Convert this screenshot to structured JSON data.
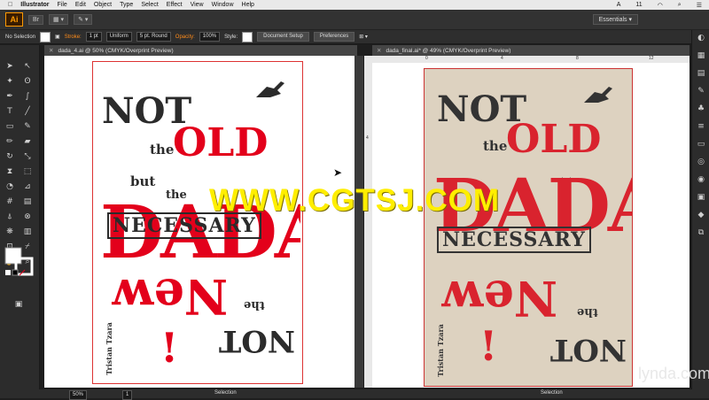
{
  "menubar": {
    "apple": "",
    "app": "Illustrator",
    "items": [
      "File",
      "Edit",
      "Object",
      "Type",
      "Select",
      "Effect",
      "View",
      "Window",
      "Help"
    ],
    "right": [
      "11"
    ]
  },
  "app_bar": {
    "logo": "Ai",
    "bridge": "Br",
    "workspace": "Essentials"
  },
  "control_bar": {
    "selection": "No Selection",
    "stroke_label": "Stroke:",
    "stroke_value": "1 pt",
    "uniform": "Uniform",
    "brush": "5 pt. Round",
    "opacity_label": "Opacity:",
    "opacity_value": "100%",
    "style_label": "Style:",
    "doc_setup": "Document Setup",
    "preferences": "Preferences"
  },
  "doc_left": {
    "tab": "dada_4.ai @ 50% (CMYK/Overprint Preview)",
    "zoom": "50%",
    "page": "1",
    "status": "Selection"
  },
  "doc_right": {
    "tab": "dada_final.ai* @ 49% (CMYK/Overprint Preview)",
    "status": "Selection",
    "ruler_top": [
      "0",
      "4",
      "8",
      "12"
    ],
    "ruler_left": [
      "4",
      "8"
    ]
  },
  "poster": {
    "not": "NOT",
    "the1": "the",
    "old": "OLD",
    "but": "but",
    "the2": "the",
    "dada": "DADA",
    "necessary": "NECESSARY",
    "new": "New",
    "the3": "the",
    "not2": "NOT",
    "exclaim": "!",
    "author": "Tristan Tzara"
  },
  "overlay": {
    "watermark": "WWW.CGTSJ.COM",
    "brand": "lynda.com"
  },
  "colors": {
    "red": "#e3001b",
    "dark": "#2b2b2b",
    "accent": "#ff8c1a",
    "paper": "#ddd2c0"
  }
}
